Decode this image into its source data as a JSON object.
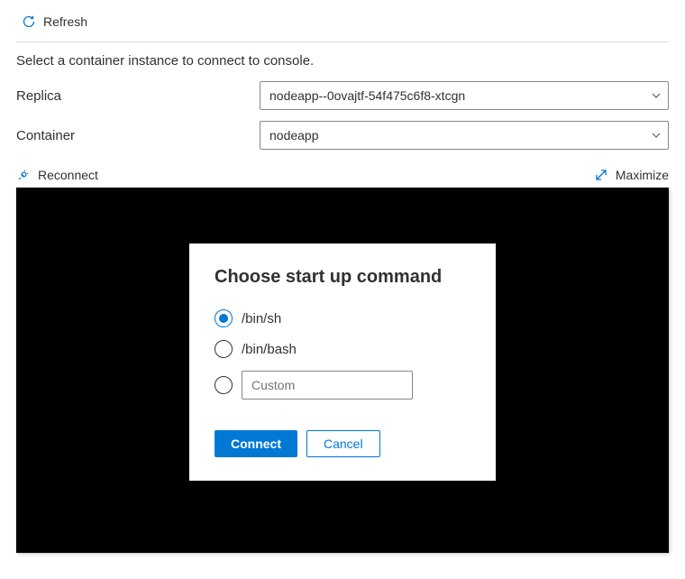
{
  "topbar": {
    "refresh_label": "Refresh"
  },
  "instruction": "Select a container instance to connect to console.",
  "form": {
    "replica": {
      "label": "Replica",
      "selected": "nodeapp--0ovajtf-54f475c6f8-xtcgn"
    },
    "container": {
      "label": "Container",
      "selected": "nodeapp"
    }
  },
  "terminal_bar": {
    "reconnect_label": "Reconnect",
    "maximize_label": "Maximize"
  },
  "dialog": {
    "title": "Choose start up command",
    "options": {
      "sh": "/bin/sh",
      "bash": "/bin/bash",
      "custom_placeholder": "Custom"
    },
    "selected": "sh",
    "connect_label": "Connect",
    "cancel_label": "Cancel"
  }
}
